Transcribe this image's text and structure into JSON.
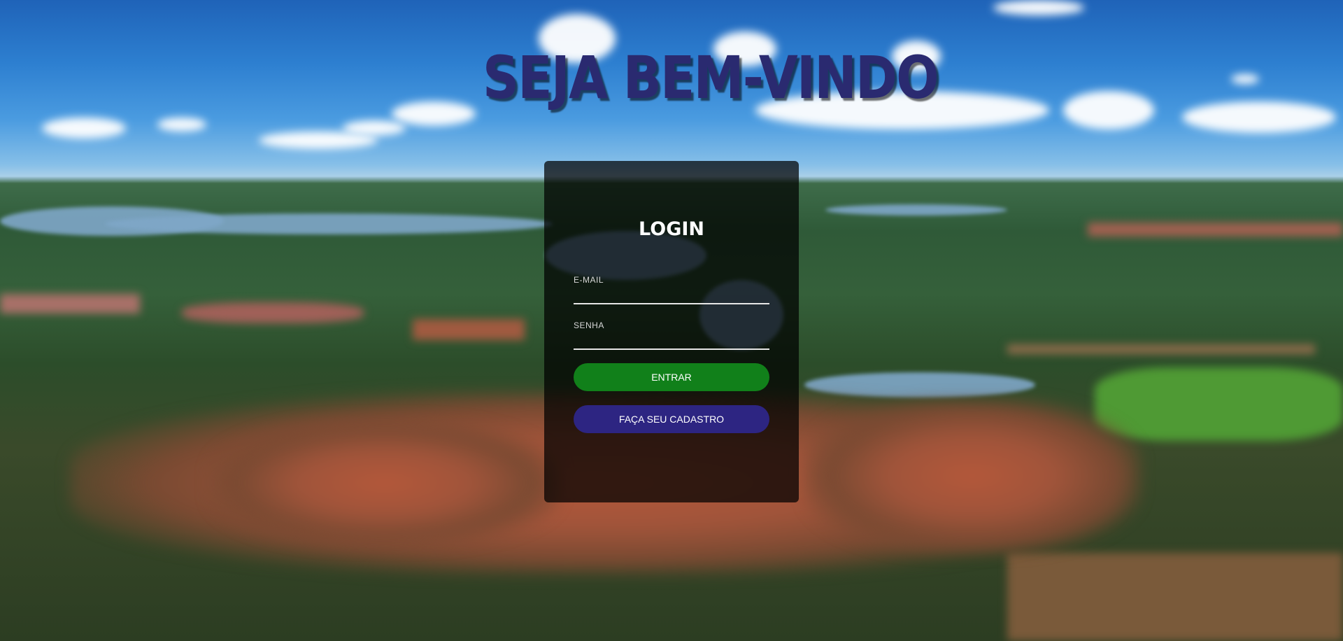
{
  "headline": "SEJA BEM-VINDO",
  "login": {
    "title": "LOGIN",
    "email_label": "E-MAIL",
    "email_value": "",
    "password_label": "SENHA",
    "password_value": "",
    "submit_label": "ENTRAR",
    "register_label": "FAÇA SEU CADASTRO"
  },
  "colors": {
    "headline": "#2a2a70",
    "panel_overlay": "rgba(0,0,0,0.72)",
    "login_button": "#11801a",
    "register_button": "#2d2582"
  },
  "background": {
    "icon": "aerial-landscape-photo"
  }
}
